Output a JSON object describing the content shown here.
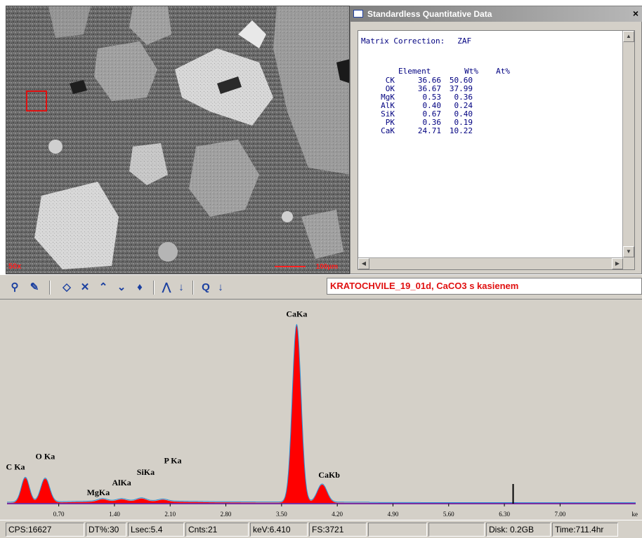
{
  "sem_image": {
    "magnification": "50x",
    "scale_label": "100µm"
  },
  "quant_window": {
    "title": "Standardless Quantitative Data",
    "close_glyph": "×",
    "matrix_label": "Matrix Correction:",
    "matrix_value": "ZAF",
    "headers": [
      "Element",
      "Wt%",
      "At%"
    ],
    "rows": [
      {
        "element": "CK",
        "wt": "36.66",
        "at": "50.60"
      },
      {
        "element": "OK",
        "wt": "36.67",
        "at": "37.99"
      },
      {
        "element": "MgK",
        "wt": "0.53",
        "at": "0.36"
      },
      {
        "element": "AlK",
        "wt": "0.40",
        "at": "0.24"
      },
      {
        "element": "SiK",
        "wt": "0.67",
        "at": "0.40"
      },
      {
        "element": "PK",
        "wt": "0.36",
        "at": "0.19"
      },
      {
        "element": "CaK",
        "wt": "24.71",
        "at": "10.22"
      }
    ]
  },
  "toolbar": {
    "icons": [
      "probe-icon",
      "brush-icon",
      "expand-icon",
      "contract-icon",
      "raise-icon",
      "lower-icon",
      "palette-icon",
      "peaks-icon",
      "zoom-icon"
    ],
    "spectrum_title": "KRATOCHVILE_19_01d, CaCO3 s kasienem"
  },
  "chart_data": {
    "type": "area",
    "xlabel": "ke",
    "x_ticks": [
      "0.70",
      "1.40",
      "2.10",
      "2.80",
      "3.50",
      "4.20",
      "4.90",
      "5.60",
      "6.30",
      "7.00"
    ],
    "xlim": [
      0.05,
      7.95
    ],
    "ylim": [
      0,
      3721
    ],
    "peaks": [
      {
        "label": "C Ka",
        "kev": 0.28,
        "counts": 520
      },
      {
        "label": "O Ka",
        "kev": 0.53,
        "counts": 500
      },
      {
        "label": "MgKa",
        "kev": 1.25,
        "counts": 50
      },
      {
        "label": "AlKa",
        "kev": 1.49,
        "counts": 45
      },
      {
        "label": "SiKa",
        "kev": 1.74,
        "counts": 60
      },
      {
        "label": "P Ka",
        "kev": 2.01,
        "counts": 40
      },
      {
        "label": "CaKa",
        "kev": 3.69,
        "counts": 3721
      },
      {
        "label": "CaKb",
        "kev": 4.01,
        "counts": 380
      }
    ],
    "marker_kev": 6.41,
    "colors": {
      "fill": "#ff0000",
      "outline": "#2a8fd6",
      "baseline": "#7b2fa0"
    }
  },
  "status_bar": {
    "cps": "CPS:16627",
    "dt": "DT%:30",
    "lsec": "Lsec:5.4",
    "cnts": "Cnts:21",
    "kev": "keV:6.410",
    "fs": "FS:3721",
    "disk": "Disk: 0.2GB",
    "time": "Time:711.4hr"
  }
}
